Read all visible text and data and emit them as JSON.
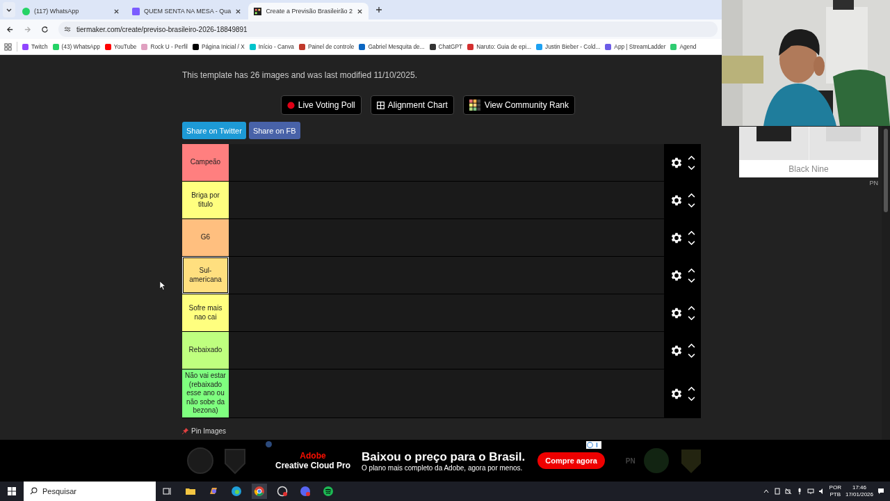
{
  "browser": {
    "tabs": [
      {
        "title": "(117) WhatsApp",
        "selected": false
      },
      {
        "title": "QUEM SENTA NA MESA - Qua",
        "selected": false
      },
      {
        "title": "Create a Previsão Brasileirão 2",
        "selected": true
      }
    ],
    "url": "tiermaker.com/create/previso-brasileiro-2026-18849891",
    "bookmarks": [
      {
        "label": "Twitch",
        "color": "#9146ff"
      },
      {
        "label": "(43) WhatsApp",
        "color": "#25d366"
      },
      {
        "label": "YouTube",
        "color": "#ff0000"
      },
      {
        "label": "Rock U - Perfil",
        "color": "#e0a0c0"
      },
      {
        "label": "Página Inicial / X",
        "color": "#000000"
      },
      {
        "label": "Início - Canva",
        "color": "#00c4cc"
      },
      {
        "label": "Painel de controle",
        "color": "#c0392b"
      },
      {
        "label": "Gabriel Mesquita de...",
        "color": "#0a66c2"
      },
      {
        "label": "ChatGPT",
        "color": "#333333"
      },
      {
        "label": "Naruto: Guia de epi...",
        "color": "#d32f2f"
      },
      {
        "label": "Justin Bieber - Cold...",
        "color": "#1da1f2"
      },
      {
        "label": "App | StreamLadder",
        "color": "#6c5ce7"
      },
      {
        "label": "Agend",
        "color": "#2ecc71"
      }
    ]
  },
  "page": {
    "template_info": "This template has 26 images and was last modified 11/10/2025.",
    "actions": [
      {
        "label": "Live Voting Poll",
        "kind": "poll"
      },
      {
        "label": "Alignment Chart",
        "kind": "alignment"
      },
      {
        "label": "View Community Rank",
        "kind": "rank"
      }
    ],
    "share": [
      {
        "label": "Share on Twitter",
        "kind": "twitter"
      },
      {
        "label": "Share on FB",
        "kind": "facebook"
      }
    ],
    "tiers": [
      {
        "label": "Campeão",
        "color": "#ff7f7f",
        "selected": false
      },
      {
        "label": "Briga por titulo",
        "color": "#ffff7f",
        "selected": false
      },
      {
        "label": "G6",
        "color": "#ffbf7f",
        "selected": false
      },
      {
        "label": "Sul-americana",
        "color": "#ffdf7f",
        "selected": true
      },
      {
        "label": "Sofre mais nao cai",
        "color": "#ffff7f",
        "selected": false
      },
      {
        "label": "Rebaixado",
        "color": "#bfff7f",
        "selected": false
      },
      {
        "label": "Não vai estar (rebaixado esse ano ou não sobe da bezona)",
        "color": "#7fff7f",
        "selected": false
      }
    ],
    "pin_images": "Pin Images"
  },
  "side_ad": {
    "caption": "Black Nine",
    "tag": "PN"
  },
  "banner_ad": {
    "brand": "Adobe",
    "product": "Creative Cloud Pro",
    "headline": "Baixou o preço para o Brasil.",
    "subline": "O plano mais completo da Adobe, agora por menos.",
    "cta": "Compre agora",
    "tag": "PN"
  },
  "taskbar": {
    "search_placeholder": "Pesquisar",
    "language": "POR",
    "layout": "PTB",
    "time": "17:46",
    "date": "17/01/2026"
  }
}
